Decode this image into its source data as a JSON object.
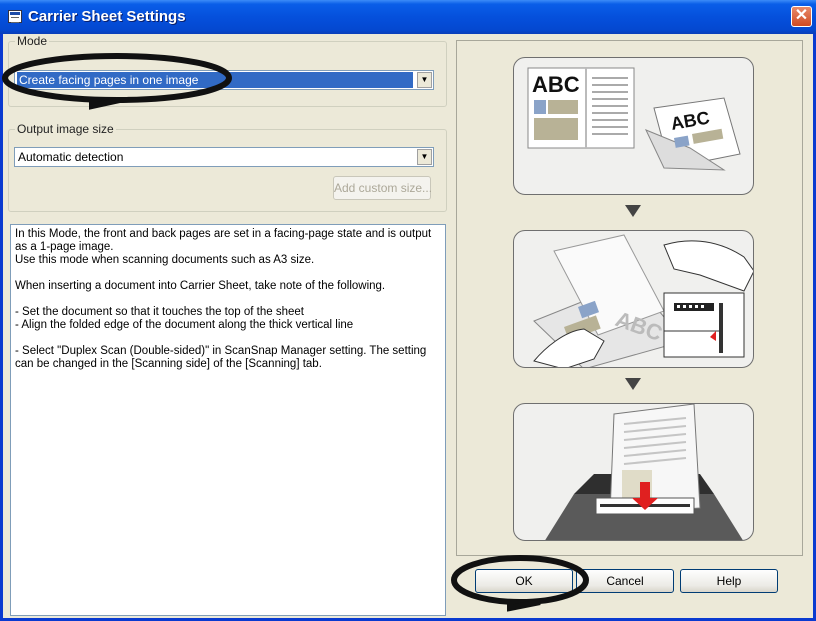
{
  "window": {
    "title": "Carrier Sheet Settings",
    "close_label": "✕"
  },
  "mode": {
    "legend": "Mode",
    "selected": "Create facing pages in one image"
  },
  "output": {
    "legend": "Output image size",
    "selected": "Automatic detection",
    "add_custom_label": "Add custom size..."
  },
  "description": {
    "lines": [
      "In this Mode, the front and back pages are set in a facing-page state and is output as a 1-page image.",
      "Use this mode when scanning documents such as A3 size.",
      "",
      "When inserting a document into Carrier Sheet, take note of the following.",
      "",
      "- Set the document so that it touches the top of the sheet",
      "- Align the folded edge of the document along the thick vertical line",
      "",
      "- Select \"Duplex Scan (Double-sided)\" in ScanSnap Manager setting. The setting can be changed in the [Scanning side] of the [Scanning] tab."
    ]
  },
  "illustration": {
    "abc_text_1": "ABC",
    "abc_text_2": "ABC",
    "abc_text_3": "ABC"
  },
  "buttons": {
    "ok": "OK",
    "cancel": "Cancel",
    "help": "Help"
  },
  "colors": {
    "titlebar": "#0550dc",
    "selection": "#316ac5",
    "annotation": "#000000",
    "dialog_bg": "#ece9d8"
  }
}
